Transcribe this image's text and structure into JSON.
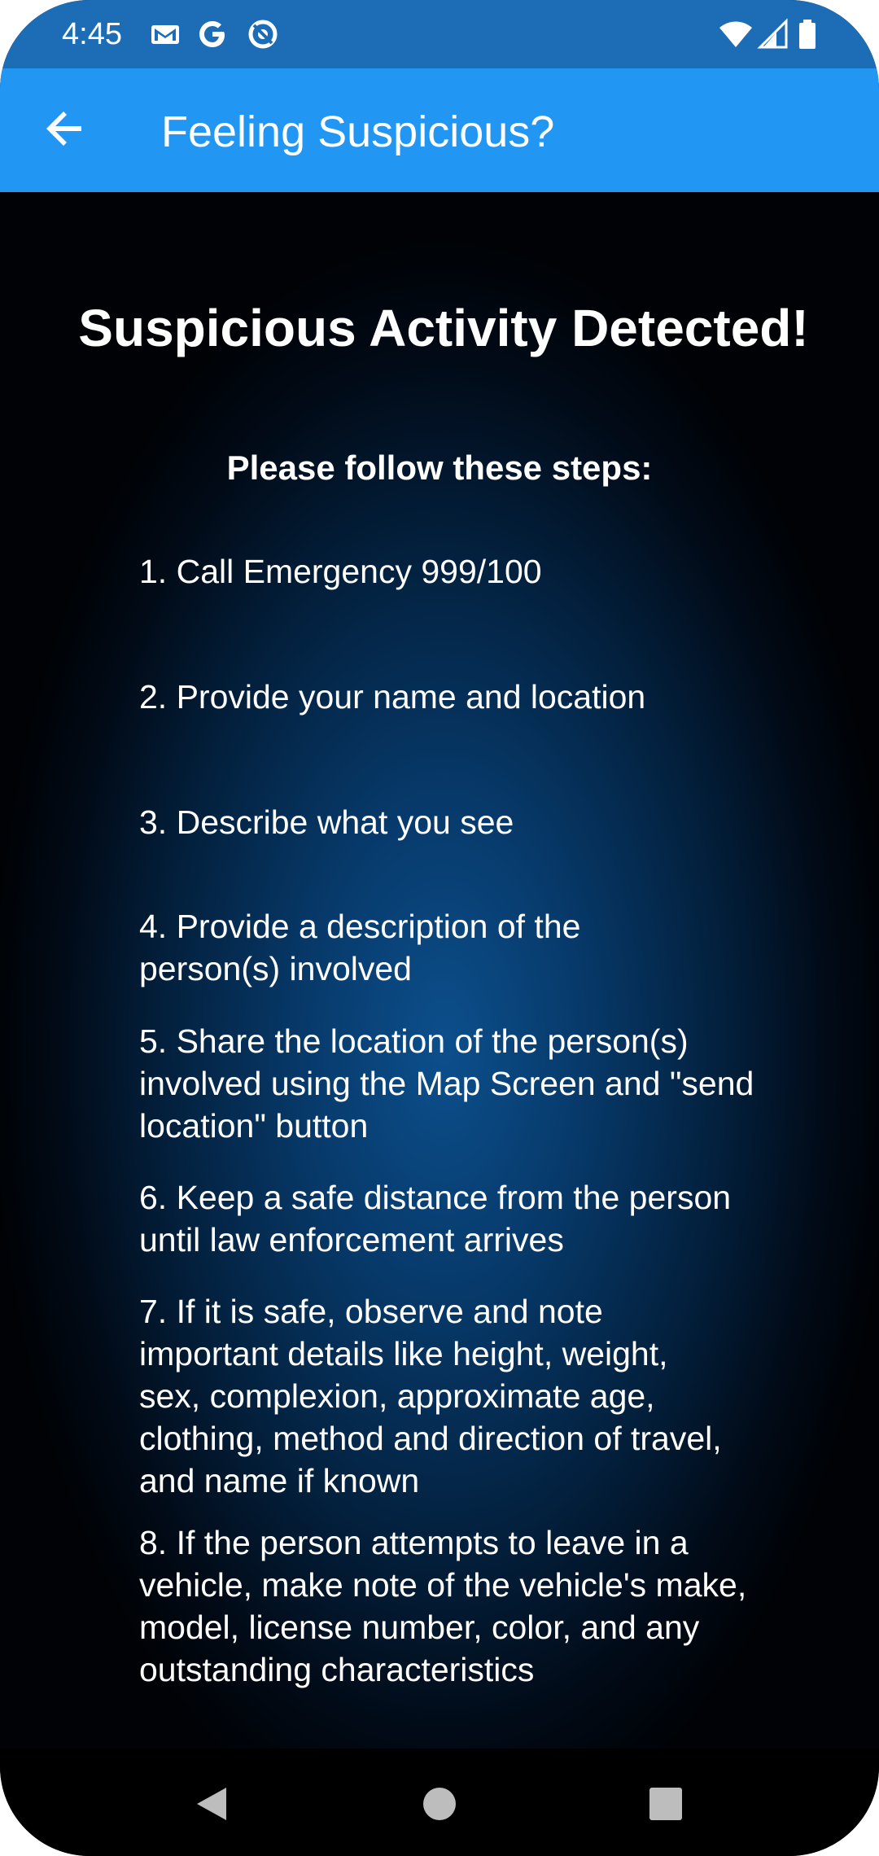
{
  "status_bar": {
    "time": "4:45",
    "left_icons": [
      "gmail-icon",
      "google-icon",
      "data-saver-icon"
    ],
    "right_icons": [
      "wifi-icon",
      "cell-signal-icon",
      "battery-icon"
    ]
  },
  "app_bar": {
    "back_icon": "arrow-left-icon",
    "title": "Feeling Suspicious?",
    "color": "#2196f3"
  },
  "content": {
    "heading": "Suspicious Activity Detected!",
    "subheading": "Please follow these steps:",
    "steps": [
      "1. Call Emergency 999/100",
      "2. Provide your name and location",
      "3. Describe what you see",
      "4. Provide a description of the person(s) involved",
      "5. Share the location of the person(s) involved using the Map Screen and \"send location\" button",
      "6. Keep a safe distance from the person until law enforcement arrives",
      "7. If it is safe, observe and note important details like height, weight, sex, complexion, approximate age, clothing, method and direction of travel, and name if known",
      "8. If the person attempts to leave in a vehicle, make note of the vehicle's make, model, license number, color, and any outstanding characteristics"
    ]
  },
  "nav_bar": {
    "buttons": [
      "back-triangle-icon",
      "home-circle-icon",
      "recents-square-icon"
    ]
  },
  "colors": {
    "status_bar": "#1c6db5",
    "app_bar": "#2196f3",
    "background_center": "#0c4f8c",
    "background_edge": "#000205",
    "text": "#ffffff"
  }
}
